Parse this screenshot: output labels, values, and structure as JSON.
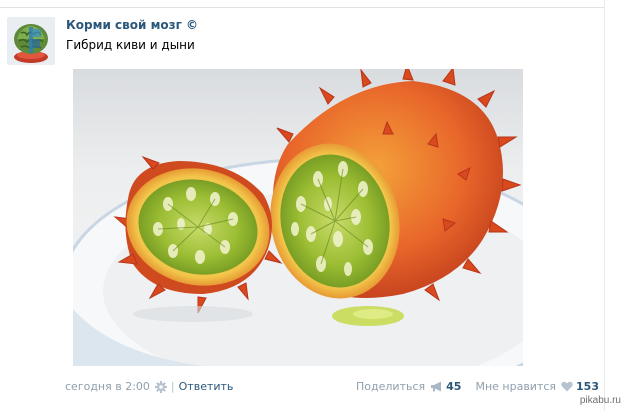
{
  "post": {
    "author": "Корми свой мозг ©",
    "text": "Гибрид киви и дыни",
    "photo_subject": "kiwano-fruit"
  },
  "footer": {
    "date": "сегодня в 2:00",
    "separator": "|",
    "reply_label": "Ответить",
    "share_label": "Поделиться",
    "share_count": "45",
    "like_label": "Мне нравится",
    "like_count": "153"
  },
  "icons": {
    "settings": "gear-icon",
    "share": "megaphone-icon",
    "like": "heart-icon"
  },
  "watermark": "pikabu.ru",
  "colors": {
    "link": "#2b587a",
    "muted": "#909fad",
    "fruit_skin": "#e8662a",
    "fruit_flesh": "#8fb62d"
  }
}
